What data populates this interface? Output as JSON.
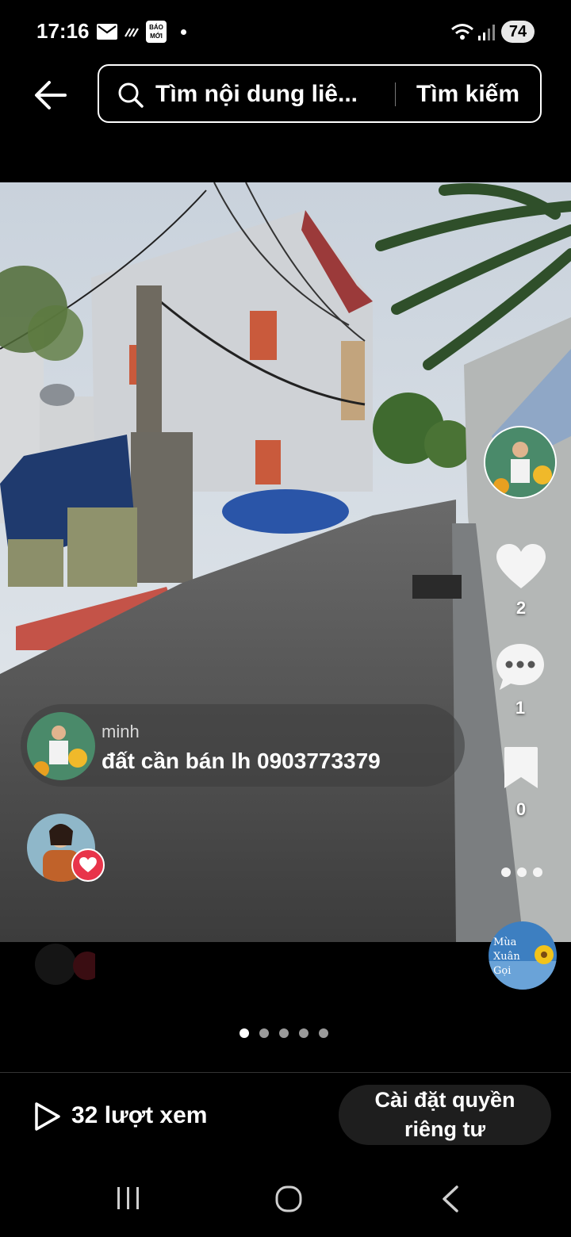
{
  "status_bar": {
    "time": "17:16",
    "battery": "74",
    "icons": [
      "mail-icon",
      "wifi-calling-icon",
      "bao-moi-icon",
      "dot-icon",
      "wifi-icon",
      "signal-icon"
    ],
    "bao_moi_line1": "BÁO",
    "bao_moi_line2": "MỚI"
  },
  "header": {
    "search_placeholder": "Tìm nội dung liê...",
    "search_button": "Tìm kiếm"
  },
  "post": {
    "like_count": "2",
    "comment_count": "1",
    "bookmark_count": "0",
    "music_disc_text": "Mùa Xuân Gọi"
  },
  "comment": {
    "author": "minh",
    "text": "đất cần bán lh 0903773379"
  },
  "pager": {
    "total": 5,
    "active": 0
  },
  "footer": {
    "views": "32 lượt xem",
    "privacy_button": "Cài đặt quyền riêng tư"
  },
  "colors": {
    "background": "#000000",
    "heart": "#e8344a",
    "button_bg": "#1e1e1e"
  }
}
